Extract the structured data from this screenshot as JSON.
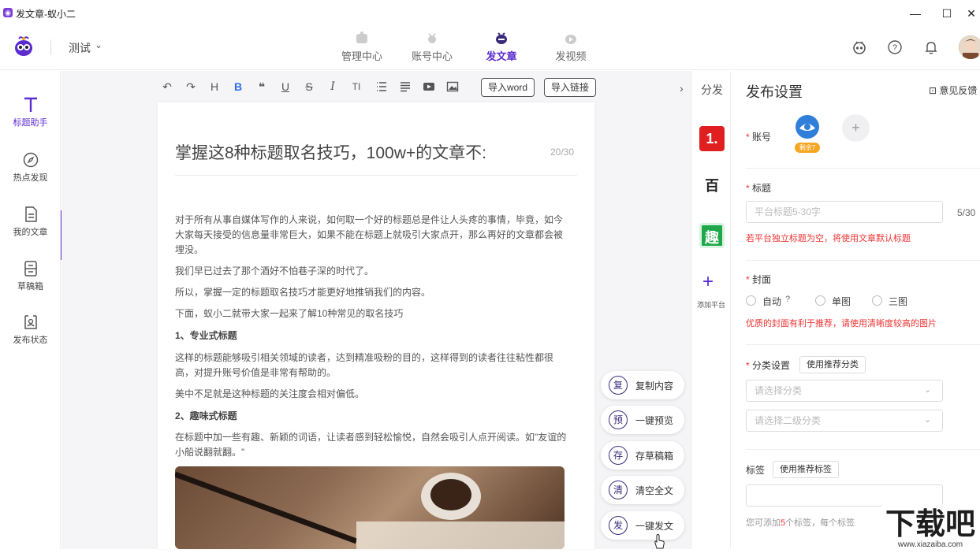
{
  "window": {
    "title": "发文章-蚁小二",
    "minimize": "—",
    "maximize": "☐",
    "close": "✕"
  },
  "header": {
    "workspace": "测试",
    "tabs": [
      {
        "label": "管理中心",
        "active": false
      },
      {
        "label": "账号中心",
        "active": false
      },
      {
        "label": "发文章",
        "active": true
      },
      {
        "label": "发视频",
        "active": false
      }
    ]
  },
  "sidebar": {
    "items": [
      {
        "label": "标题助手",
        "icon": "T"
      },
      {
        "label": "热点发现",
        "icon": "compass"
      },
      {
        "label": "我的文章",
        "icon": "doc"
      },
      {
        "label": "草稿箱",
        "icon": "drafts"
      },
      {
        "label": "发布状态",
        "icon": "status"
      }
    ]
  },
  "toolbar": {
    "undo": "↶",
    "redo": "↷",
    "h": "H",
    "bold": "B",
    "quote": "❝",
    "underline": "U",
    "strike": "S",
    "italic": "I",
    "size": "TI",
    "import_word": "导入word",
    "import_link": "导入链接"
  },
  "article": {
    "title": "掌握这8种标题取名技巧，100w+的文章不:",
    "title_count": "20/30",
    "paragraphs": [
      "对于所有从事自媒体写作的人来说，如何取一个好的标题总是件让人头疼的事情，毕竟，如今大家每天接受的信息量非常巨大，如果不能在标题上就吸引大家点开，那么再好的文章都会被埋没。",
      "我们早已过去了那个酒好不怕巷子深的时代了。",
      "所以，掌握一定的标题取名技巧才能更好地推销我们的内容。",
      "下面，蚁小二就带大家一起来了解10种常见的取名技巧",
      "1、专业式标题",
      "这样的标题能够吸引相关领域的读者，达到精准吸粉的目的，这样得到的读者往往粘性都很高，对提升账号价值是非常有帮助的。",
      "美中不足就是这种标题的关注度会相对偏低。",
      "2、趣味式标题",
      "在标题中加一些有趣、新颖的词语，让读者感到轻松愉悦，自然会吸引人点开阅读。如\"友谊的小船说翻就翻。\""
    ]
  },
  "actions": [
    {
      "char": "复",
      "label": "复制内容"
    },
    {
      "char": "预",
      "label": "一键预览"
    },
    {
      "char": "存",
      "label": "存草稿箱"
    },
    {
      "char": "清",
      "label": "清空全文"
    },
    {
      "char": "发",
      "label": "一键发文"
    }
  ],
  "platforms": {
    "toggle": "分发",
    "items": [
      {
        "name": "一点资讯",
        "glyph": "1.",
        "color": "#e02020"
      },
      {
        "name": "百家号",
        "glyph": "百",
        "color": "#ffffff"
      },
      {
        "name": "趣头条",
        "glyph": "趣",
        "color": "#1fa84a"
      }
    ],
    "add_label": "添加平台"
  },
  "settings": {
    "title": "发布设置",
    "feedback": "意见反馈",
    "account_label": "账号",
    "account_badge": "剩余7",
    "headline_label": "标题",
    "headline_placeholder": "平台标题5-30字",
    "headline_count": "5/30",
    "headline_hint": "若平台独立标题为空，将使用文章默认标题",
    "cover_label": "封面",
    "cover_options": [
      "自动",
      "单图",
      "三图"
    ],
    "cover_hint": "优质的封面有利于推荐，请使用清晰度较高的图片",
    "category_label": "分类设置",
    "category_btn": "使用推荐分类",
    "category_placeholder": "请选择分类",
    "subcategory_placeholder": "请选择二级分类",
    "tag_label": "标签",
    "tag_btn": "使用推荐标签",
    "tag_hint_pre": "您可添加",
    "tag_hint_num": "5",
    "tag_hint_post": "个标签，每个标签",
    "colors": {
      "accent": "#5b2bd0",
      "error": "#e33333"
    }
  },
  "watermark": {
    "text": "下载吧",
    "url": "www.xiazaiba.com"
  }
}
